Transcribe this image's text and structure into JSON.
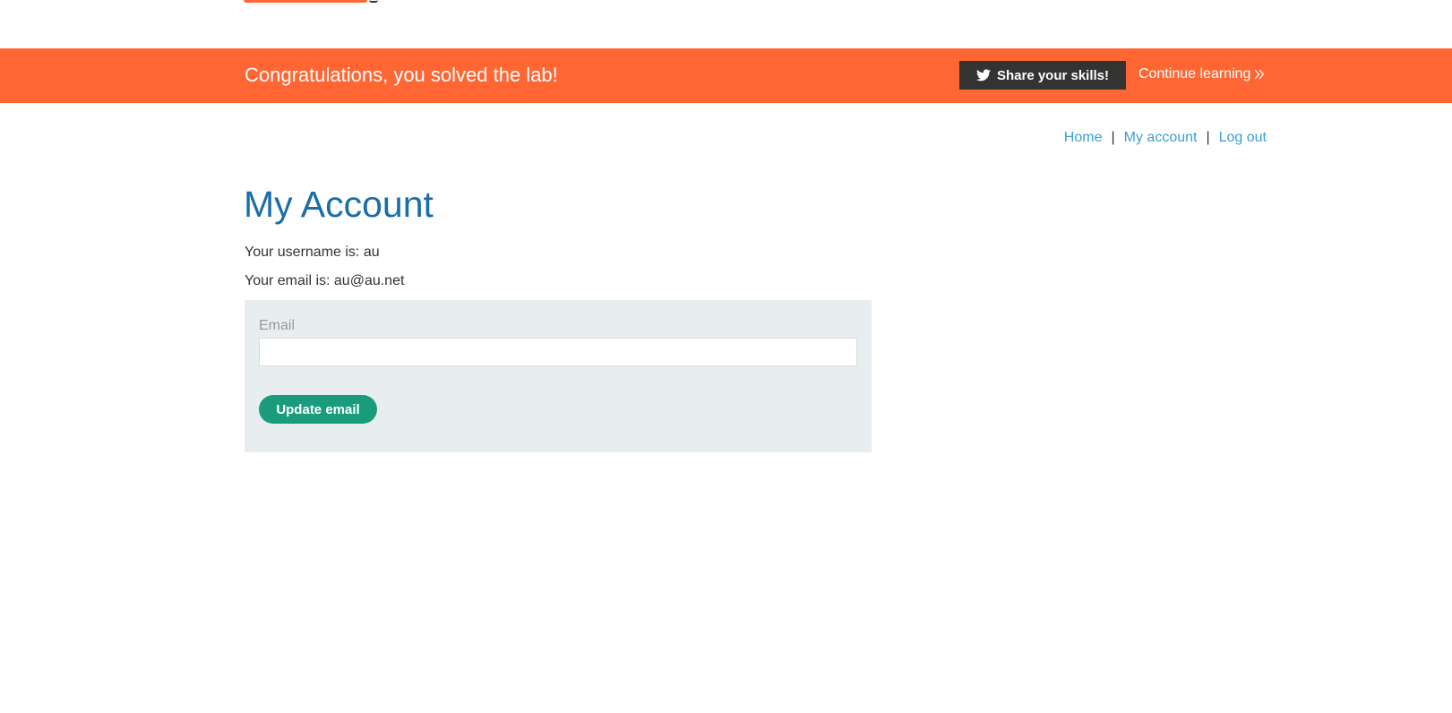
{
  "banner": {
    "title": "Congratulations, you solved the lab!",
    "share_label": "Share your skills!",
    "share_icon": "twitter-bird-icon",
    "continue_label": "Continue learning",
    "continue_icon": "double-chevron-right-icon",
    "color": "#ff6633"
  },
  "nav": {
    "home": "Home",
    "separator": "|",
    "my_account": "My account",
    "log_out": "Log out"
  },
  "page": {
    "title": "My Account",
    "username_line": "Your username is: au",
    "email_line": "Your email is: au@au.net"
  },
  "form": {
    "email_label": "Email",
    "email_value": "",
    "submit_label": "Update email",
    "submit_color": "#1a9c7c"
  }
}
